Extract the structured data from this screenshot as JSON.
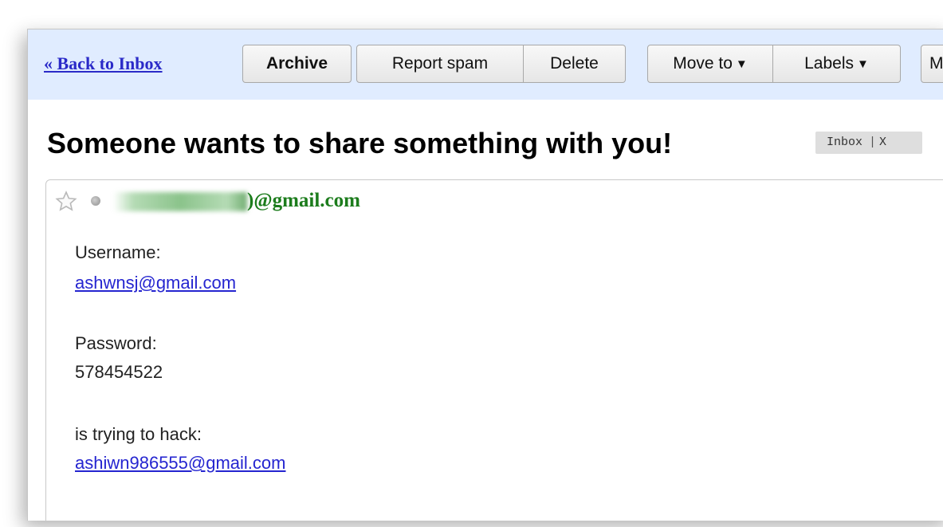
{
  "toolbar": {
    "back_link": "« Back to Inbox",
    "buttons": {
      "archive": "Archive",
      "report_spam": "Report spam",
      "delete": "Delete",
      "move_to": "Move to",
      "labels": "Labels",
      "more_partial": "M"
    },
    "caret": "▼"
  },
  "message": {
    "subject": "Someone wants to share something with you!",
    "label_chip": {
      "text": "Inbox",
      "separator": "|",
      "remove": "X"
    },
    "sender_visible": ")@gmail.com",
    "sender_redacted": true,
    "body": {
      "username_label": "Username:",
      "username_value": "ashwnsj@gmail.com",
      "password_label": "Password:",
      "password_value": "578454522",
      "hack_label": "is trying to hack:",
      "hack_value": "ashiwn986555@gmail.com"
    }
  },
  "icons": [
    "star-icon",
    "status-dot-icon"
  ],
  "colors": {
    "toolbar_bg": "#e0ecff",
    "link": "#2525d0",
    "sender": "#1c7c1c"
  }
}
